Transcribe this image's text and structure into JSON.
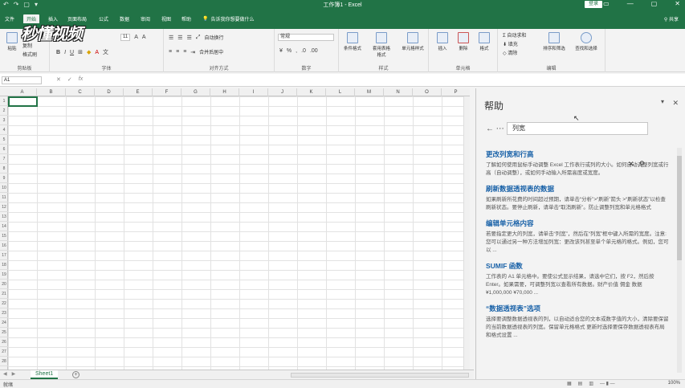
{
  "window": {
    "title": "工作簿1 - Excel",
    "signin": "登录",
    "qat": [
      "↶",
      "↷",
      "▢",
      "▾"
    ]
  },
  "tabs": [
    {
      "label": "文件"
    },
    {
      "label": "开始"
    },
    {
      "label": "插入"
    },
    {
      "label": "页面布局"
    },
    {
      "label": "公式"
    },
    {
      "label": "数据"
    },
    {
      "label": "审阅"
    },
    {
      "label": "视图"
    },
    {
      "label": "帮助"
    }
  ],
  "tellme": "告诉我你想要做什么",
  "share": "共享",
  "watermark": "秒懂视频",
  "ribbon": {
    "clipboard": {
      "label": "剪贴板",
      "paste": "粘贴",
      "cut": "剪切",
      "copy": "复制",
      "format_painter": "格式刷"
    },
    "font": {
      "label": "字体",
      "size": "11"
    },
    "alignment": {
      "label": "对齐方式",
      "wrap": "自动换行",
      "merge": "合并后居中"
    },
    "number": {
      "label": "数字",
      "format": "常规"
    },
    "styles": {
      "label": "样式",
      "conditional": "条件格式",
      "table": "套用表格格式",
      "cell_styles": "单元格样式"
    },
    "cells": {
      "label": "单元格",
      "insert": "插入",
      "delete": "删除",
      "format": "格式"
    },
    "editing": {
      "label": "编辑",
      "autosum": "自动求和",
      "fill": "填充",
      "clear": "清除",
      "sort": "排序和筛选",
      "find": "查找和选择"
    }
  },
  "formula": {
    "namebox": "A1",
    "cancel": "✕",
    "enter": "✓",
    "fx": "fx"
  },
  "columns": [
    "A",
    "B",
    "C",
    "D",
    "E",
    "F",
    "G",
    "H",
    "I",
    "J",
    "K",
    "L",
    "M",
    "N",
    "O",
    "P"
  ],
  "rows": [
    "1",
    "2",
    "3",
    "4",
    "5",
    "6",
    "7",
    "8",
    "9",
    "10",
    "11",
    "12",
    "13",
    "14",
    "15",
    "16",
    "17",
    "18",
    "19",
    "20",
    "21",
    "22",
    "23",
    "24",
    "25",
    "26",
    "27",
    "28"
  ],
  "sheets": [
    {
      "label": "Sheet1"
    }
  ],
  "add_sheet": "+",
  "status": {
    "ready": "就绪",
    "zoom": "100%"
  },
  "help": {
    "title": "帮助",
    "search_value": "列宽",
    "results": [
      {
        "title": "更改列宽和行高",
        "body": "了解如何使用鼠标手动调整 Excel 工作表行或列的大小。如何自动调整列宽或行高（自动调整），或如何手动输入所需高度或宽度。"
      },
      {
        "title": "刷新数据透视表的数据",
        "body": "如果刷新所花费的时间超过预期，请单击“分析”>“刷新”箭头 >“刷新状态”以检查刷新状态。要停止刷新，请单击“取消刷新”。防止调整列宽和单元格格式"
      },
      {
        "title": "编辑单元格内容",
        "body": "若要指定更大的列宽，请单击“列宽”，然后在“列宽”框中键入所需的宽度。注意: 您可以通过另一种方法增加列宽：更改该列甚至单个单元格的格式。例如，您可以 ..."
      },
      {
        "title": "SUMIF 函数",
        "body": "工作表的 A1 单元格中。要使公式显示结果，请选中它们，按 F2，然后按 Enter。如果需要，可调整列宽以查看所有数据。财产价值 佣金 数据 ¥1,000,000 ¥70,000 ..."
      },
      {
        "title": "“数据透视表”选项",
        "body": "选择要调整数据透视表的列，以自动适合您的文本或数字值的大小，清除要保留的当前数据透视表的列宽。保留单元格格式 更新时选择要保存数据透视表布局和格式设置 ..."
      }
    ]
  }
}
